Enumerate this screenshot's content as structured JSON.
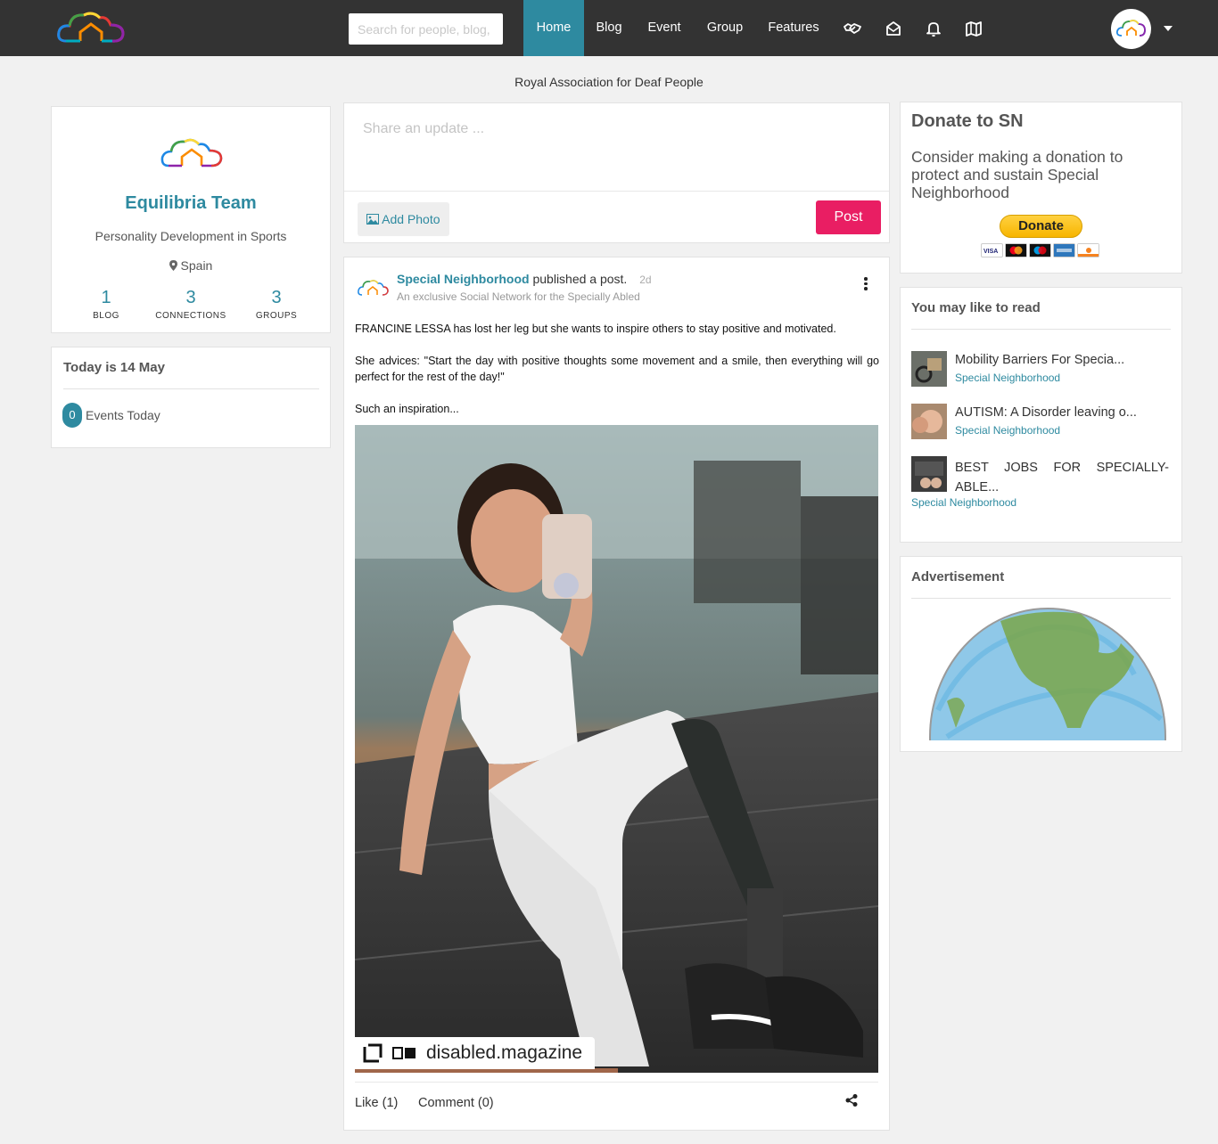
{
  "nav": {
    "search_placeholder": "Search for people, blog,",
    "items": [
      "Home",
      "Blog",
      "Event",
      "Group",
      "Features"
    ],
    "icons": [
      "handshake-icon",
      "envelope-open-icon",
      "bell-icon",
      "map-icon"
    ]
  },
  "org_name": "Royal Association for Deaf People",
  "profile": {
    "name": "Equilibria Team",
    "tagline": "Personality Development in Sports",
    "location": "Spain",
    "stats": [
      {
        "value": "1",
        "label": "BLOG"
      },
      {
        "value": "3",
        "label": "CONNECTIONS"
      },
      {
        "value": "3",
        "label": "GROUPS"
      }
    ]
  },
  "today": {
    "title": "Today is 14 May",
    "events_count": "0",
    "events_label": "Events Today"
  },
  "share": {
    "placeholder": "Share an update ...",
    "add_photo": "Add Photo",
    "post": "Post"
  },
  "post": {
    "author": "Special Neighborhood",
    "action": "published a post.",
    "time": "2d",
    "subtitle": "An exclusive Social Network for the Specially Abled",
    "paragraphs": [
      "FRANCINE LESSA has lost her leg but she wants to inspire others to stay positive and motivated.",
      "She advices: \"Start the day with positive thoughts some movement and a smile, then everything will go perfect for the rest of the day!\"",
      "Such an inspiration..."
    ],
    "watermark": "disabled.magazine",
    "like": "Like (1)",
    "comment": "Comment (0)"
  },
  "donate": {
    "title": "Donate to SN",
    "text": "Consider making a donation to protect and sustain Special Neighborhood",
    "button": "Donate"
  },
  "reading": {
    "title": "You may like to read",
    "items": [
      {
        "title": "Mobility Barriers For Specia...",
        "source": "Special Neighborhood"
      },
      {
        "title": "AUTISM: A Disorder leaving o...",
        "source": "Special Neighborhood"
      },
      {
        "title": "BEST JOBS FOR SPECIALLY-ABLE...",
        "source": "Special Neighborhood"
      }
    ]
  },
  "ad": {
    "title": "Advertisement"
  },
  "colors": {
    "accent": "#2e8aa0",
    "post_button": "#e91e63",
    "topbar": "#333333"
  }
}
